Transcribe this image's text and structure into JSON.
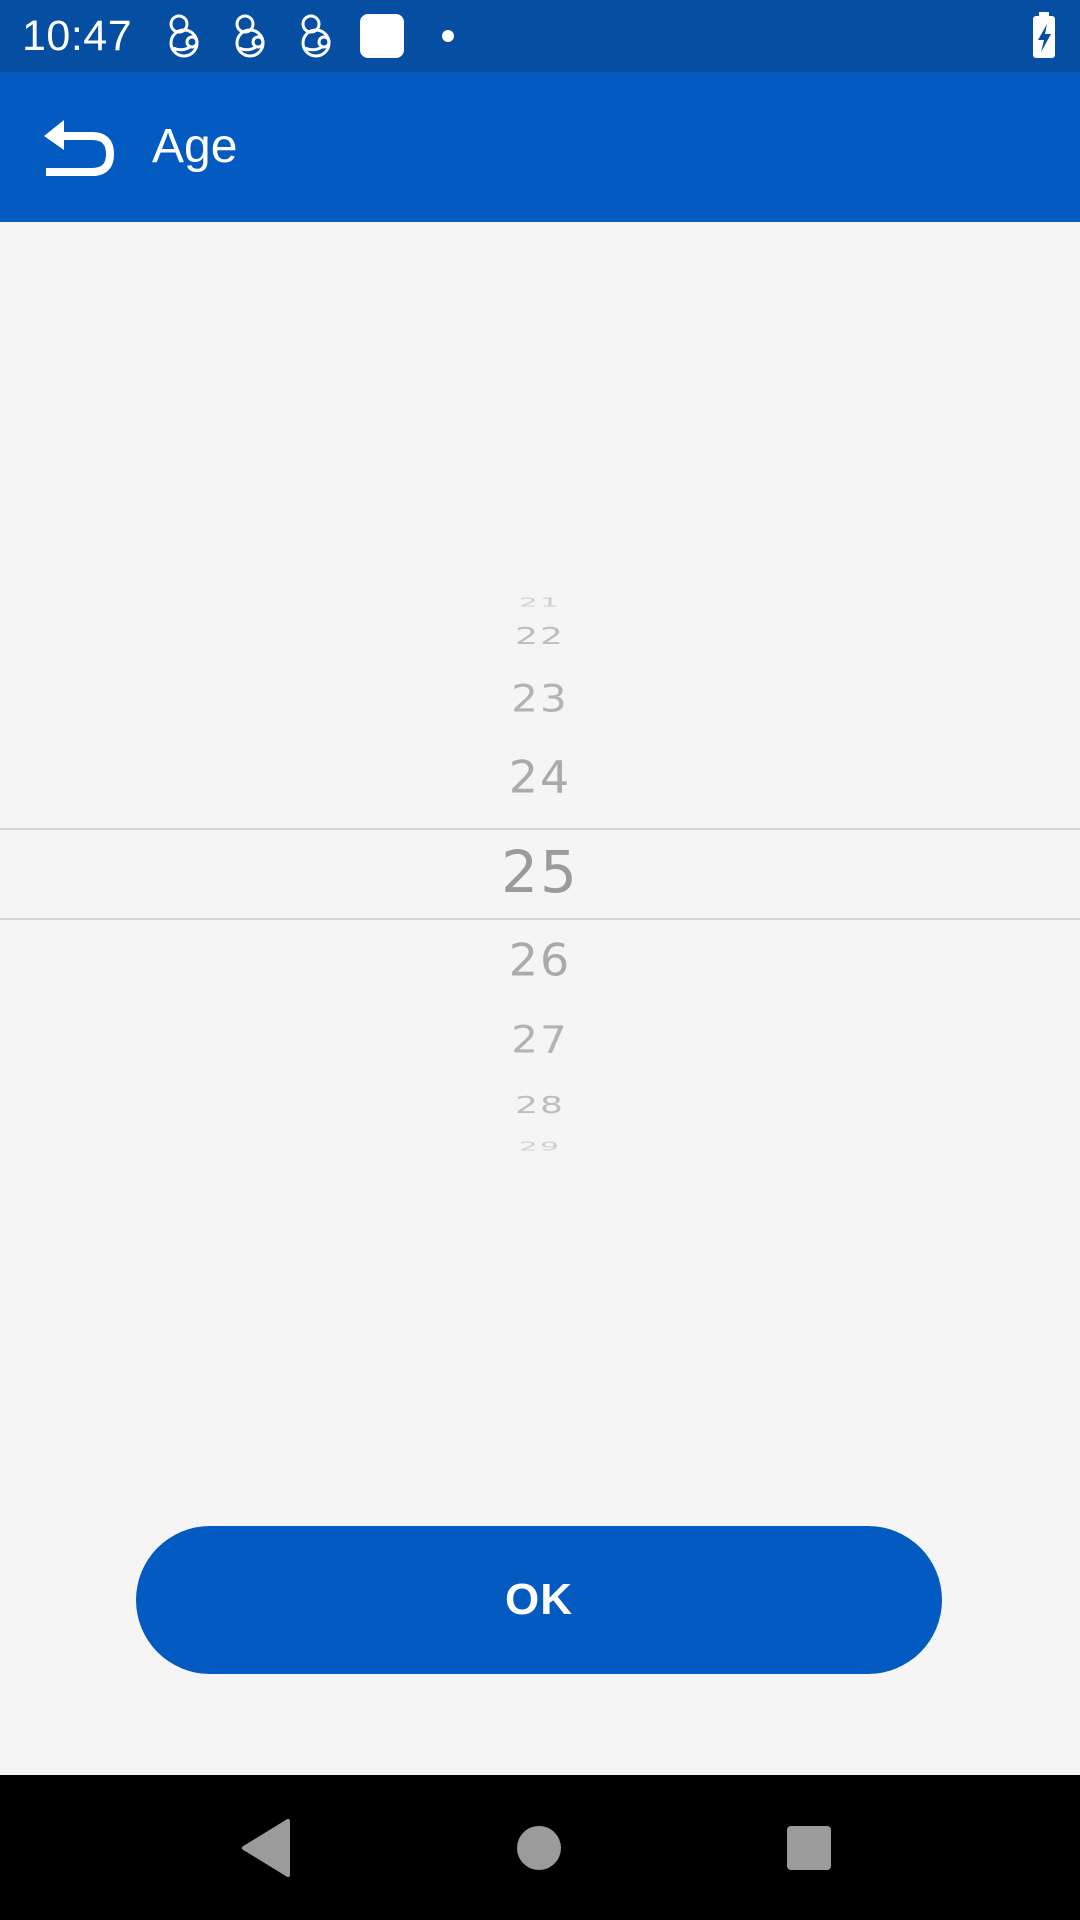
{
  "status_bar": {
    "time": "10:47",
    "icons": [
      "app-notification-icon",
      "app-notification-icon",
      "app-notification-icon",
      "square-notification-icon",
      "dot-icon",
      "battery-charging-icon"
    ]
  },
  "app_bar": {
    "title": "Age",
    "back_icon": "back-arrow-icon"
  },
  "picker": {
    "selected": "25",
    "items": [
      "21",
      "22",
      "23",
      "24",
      "25",
      "26",
      "27",
      "28",
      "29"
    ]
  },
  "ok_button": {
    "label": "OK"
  },
  "nav_bar": {
    "icons": [
      "back-triangle-icon",
      "home-circle-icon",
      "recents-square-icon"
    ]
  },
  "colors": {
    "status_bar": "#054ea1",
    "primary": "#035bc1",
    "background": "#f5f5f6",
    "picker_text": "#a7a7a7",
    "nav_bar": "#000000"
  }
}
